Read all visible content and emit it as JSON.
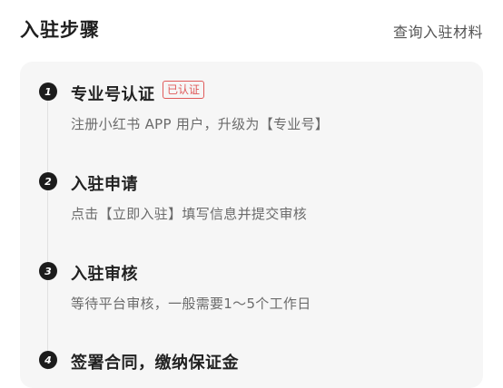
{
  "header": {
    "title": "入驻步骤",
    "link_label": "查询入驻材料"
  },
  "steps": [
    {
      "number": "1",
      "title": "专业号认证",
      "badge": "已认证",
      "desc": "注册小红书 APP 用户，升级为【专业号】"
    },
    {
      "number": "2",
      "title": "入驻申请",
      "desc": "点击【立即入驻】填写信息并提交审核"
    },
    {
      "number": "3",
      "title": "入驻审核",
      "desc": "等待平台审核，一般需要1～5个工作日"
    },
    {
      "number": "4",
      "title": "签署合同，缴纳保证金"
    }
  ],
  "colors": {
    "badge": "#e05a5a",
    "step_circle": "#1c1c1c",
    "card_bg": "#f6f6f6"
  }
}
